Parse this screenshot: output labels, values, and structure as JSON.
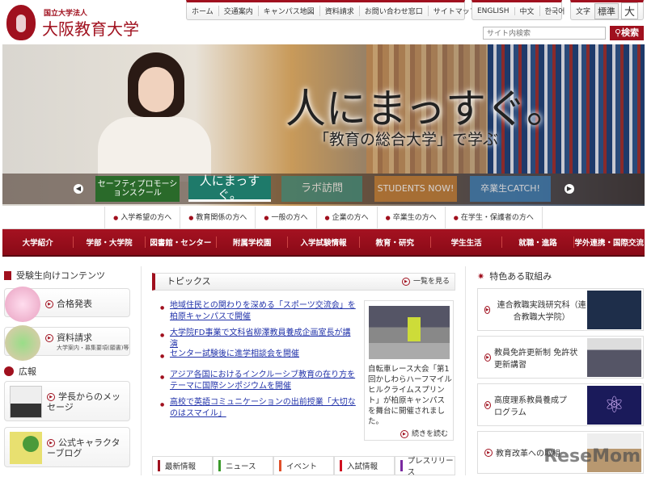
{
  "header": {
    "logo_sub": "国立大学法人",
    "logo_main": "大阪教育大学",
    "top_nav": [
      "ホーム",
      "交通案内",
      "キャンパス地図",
      "資料請求",
      "お問い合わせ窓口",
      "サイトマップ"
    ],
    "languages": [
      "ENGLISH",
      "中文",
      "한국어"
    ],
    "font_size": {
      "label": "文字",
      "standard": "標準",
      "large": "大"
    },
    "search": {
      "placeholder": "サイト内検索",
      "button": "検索"
    }
  },
  "hero": {
    "title": "人にまっすぐ。",
    "subtitle": "「教育の総合大学」で学ぶ",
    "thumbnails": [
      "セーフティプロモーションスクール",
      "人にまっすぐ。",
      "ラボ訪問",
      "STUDENTS NOW!",
      "卒業生CATCH!"
    ]
  },
  "audience_nav": [
    "入学希望の方へ",
    "教育関係の方へ",
    "一般の方へ",
    "企業の方へ",
    "卒業生の方へ",
    "在学生・保護者の方へ"
  ],
  "main_nav": [
    "大学紹介",
    "学部・大学院",
    "図書館・センター",
    "附属学校園",
    "入学試験情報",
    "教育・研究",
    "学生生活",
    "就職・進路",
    "学外連携・国際交流"
  ],
  "left": {
    "exam_heading": "受験生向けコンテンツ",
    "exam_items": [
      {
        "label": "合格発表"
      },
      {
        "label": "資料請求",
        "sub": "大学案内・募集要項(願書)等"
      }
    ],
    "pr_heading": "広報",
    "pr_items": [
      "学長からのメッセージ",
      "公式キャラクターブログ"
    ]
  },
  "topics": {
    "heading": "トピックス",
    "see_all": "一覧を見る",
    "links": [
      "地域住民との関わりを深める「スポーツ交流会」を柏原キャンパスで開催",
      "大学院FD事業で文科省柳澤教員養成企画室長が講演",
      "センター試験後に進学相談会を開催",
      "アジア各国におけるインクルーシブ教育の在り方をテーマに国際シンポジウムを開催",
      "高校で英語コミュニケーションの出前授業「大切なのはスマイル」"
    ],
    "feature": {
      "text": "自転車レース大会「第1回かしわらハーフマイルヒルクライムスプリント」が柏原キャンパスを舞台に開催されました。",
      "more": "続きを読む"
    }
  },
  "news_tabs": [
    {
      "label": "最新情報",
      "color": "#a0101e"
    },
    {
      "label": "ニュース",
      "color": "#3a9a2a"
    },
    {
      "label": "イベント",
      "color": "#e0502a"
    },
    {
      "label": "入試情報",
      "color": "#d01020"
    },
    {
      "label": "プレスリリース",
      "color": "#7a2aa0"
    }
  ],
  "right": {
    "heading": "特色ある取組み",
    "items": [
      "連合教職実践研究科（連合教職大学院）",
      "教員免許更新制 免許状更新講習",
      "高度理系教員養成プログラム",
      "教育改革への取組"
    ]
  },
  "watermark": "ReseMom"
}
